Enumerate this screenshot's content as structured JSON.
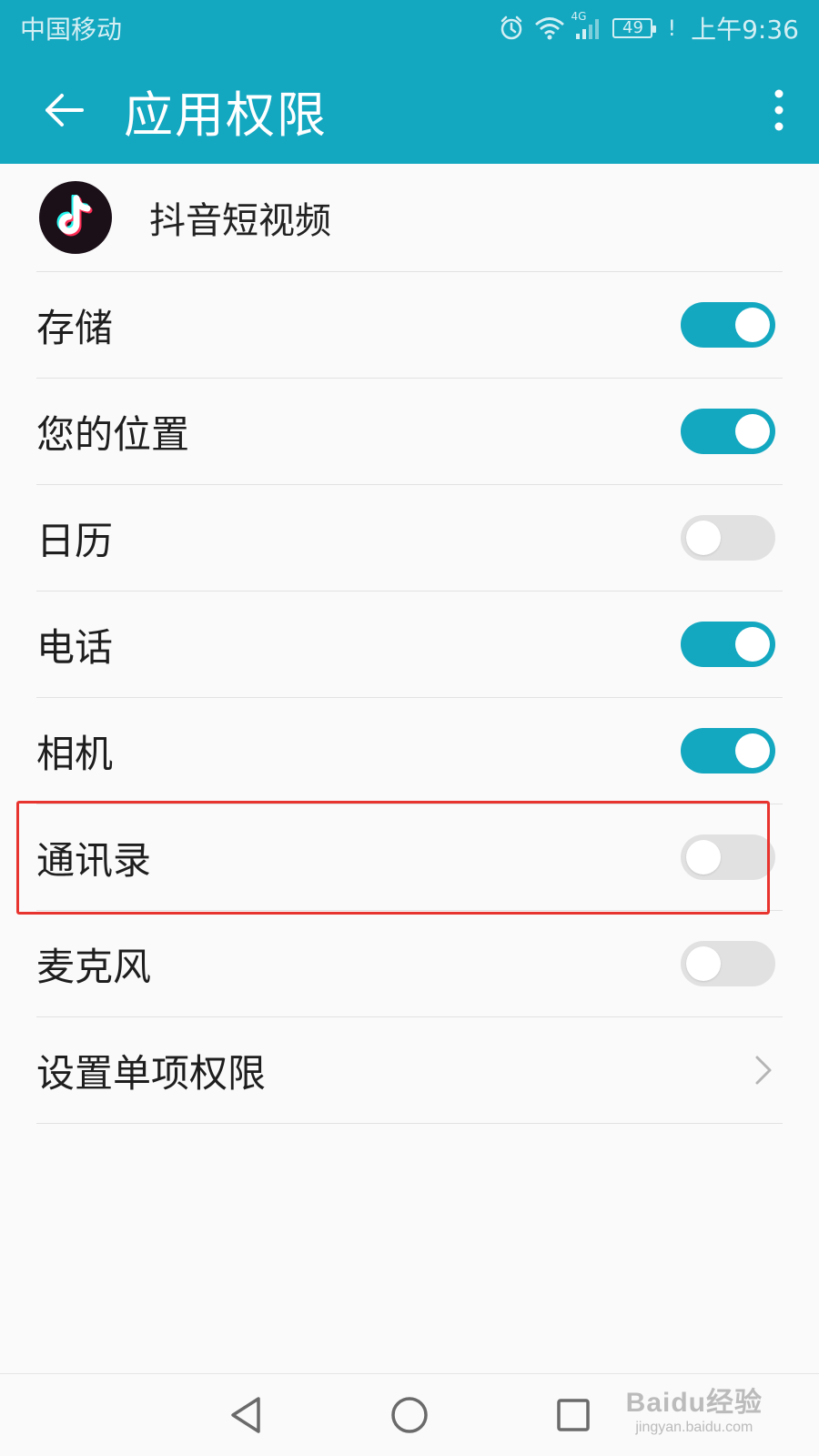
{
  "status_bar": {
    "carrier": "中国移动",
    "network": "4G",
    "battery": "49",
    "time": "上午9:36"
  },
  "app_bar": {
    "title": "应用权限",
    "back_icon": "arrow-left-icon",
    "more_icon": "more-vertical-icon"
  },
  "app": {
    "name": "抖音短视频",
    "icon": "tiktok-logo"
  },
  "permissions": [
    {
      "label": "存储",
      "enabled": true
    },
    {
      "label": "您的位置",
      "enabled": true
    },
    {
      "label": "日历",
      "enabled": false
    },
    {
      "label": "电话",
      "enabled": true
    },
    {
      "label": "相机",
      "enabled": true
    },
    {
      "label": "通讯录",
      "enabled": false,
      "highlighted": true
    },
    {
      "label": "麦克风",
      "enabled": false
    }
  ],
  "individual_permissions": {
    "label": "设置单项权限",
    "icon": "chevron-right-icon"
  },
  "nav_bar": {
    "back": "triangle-back-icon",
    "home": "circle-home-icon",
    "recents": "square-recents-icon"
  },
  "watermark": {
    "logo": "Baidu经验",
    "url": "jingyan.baidu.com"
  },
  "colors": {
    "accent": "#14a7c0",
    "toggle_off": "#e1e1e1",
    "highlight": "#e8342e"
  }
}
